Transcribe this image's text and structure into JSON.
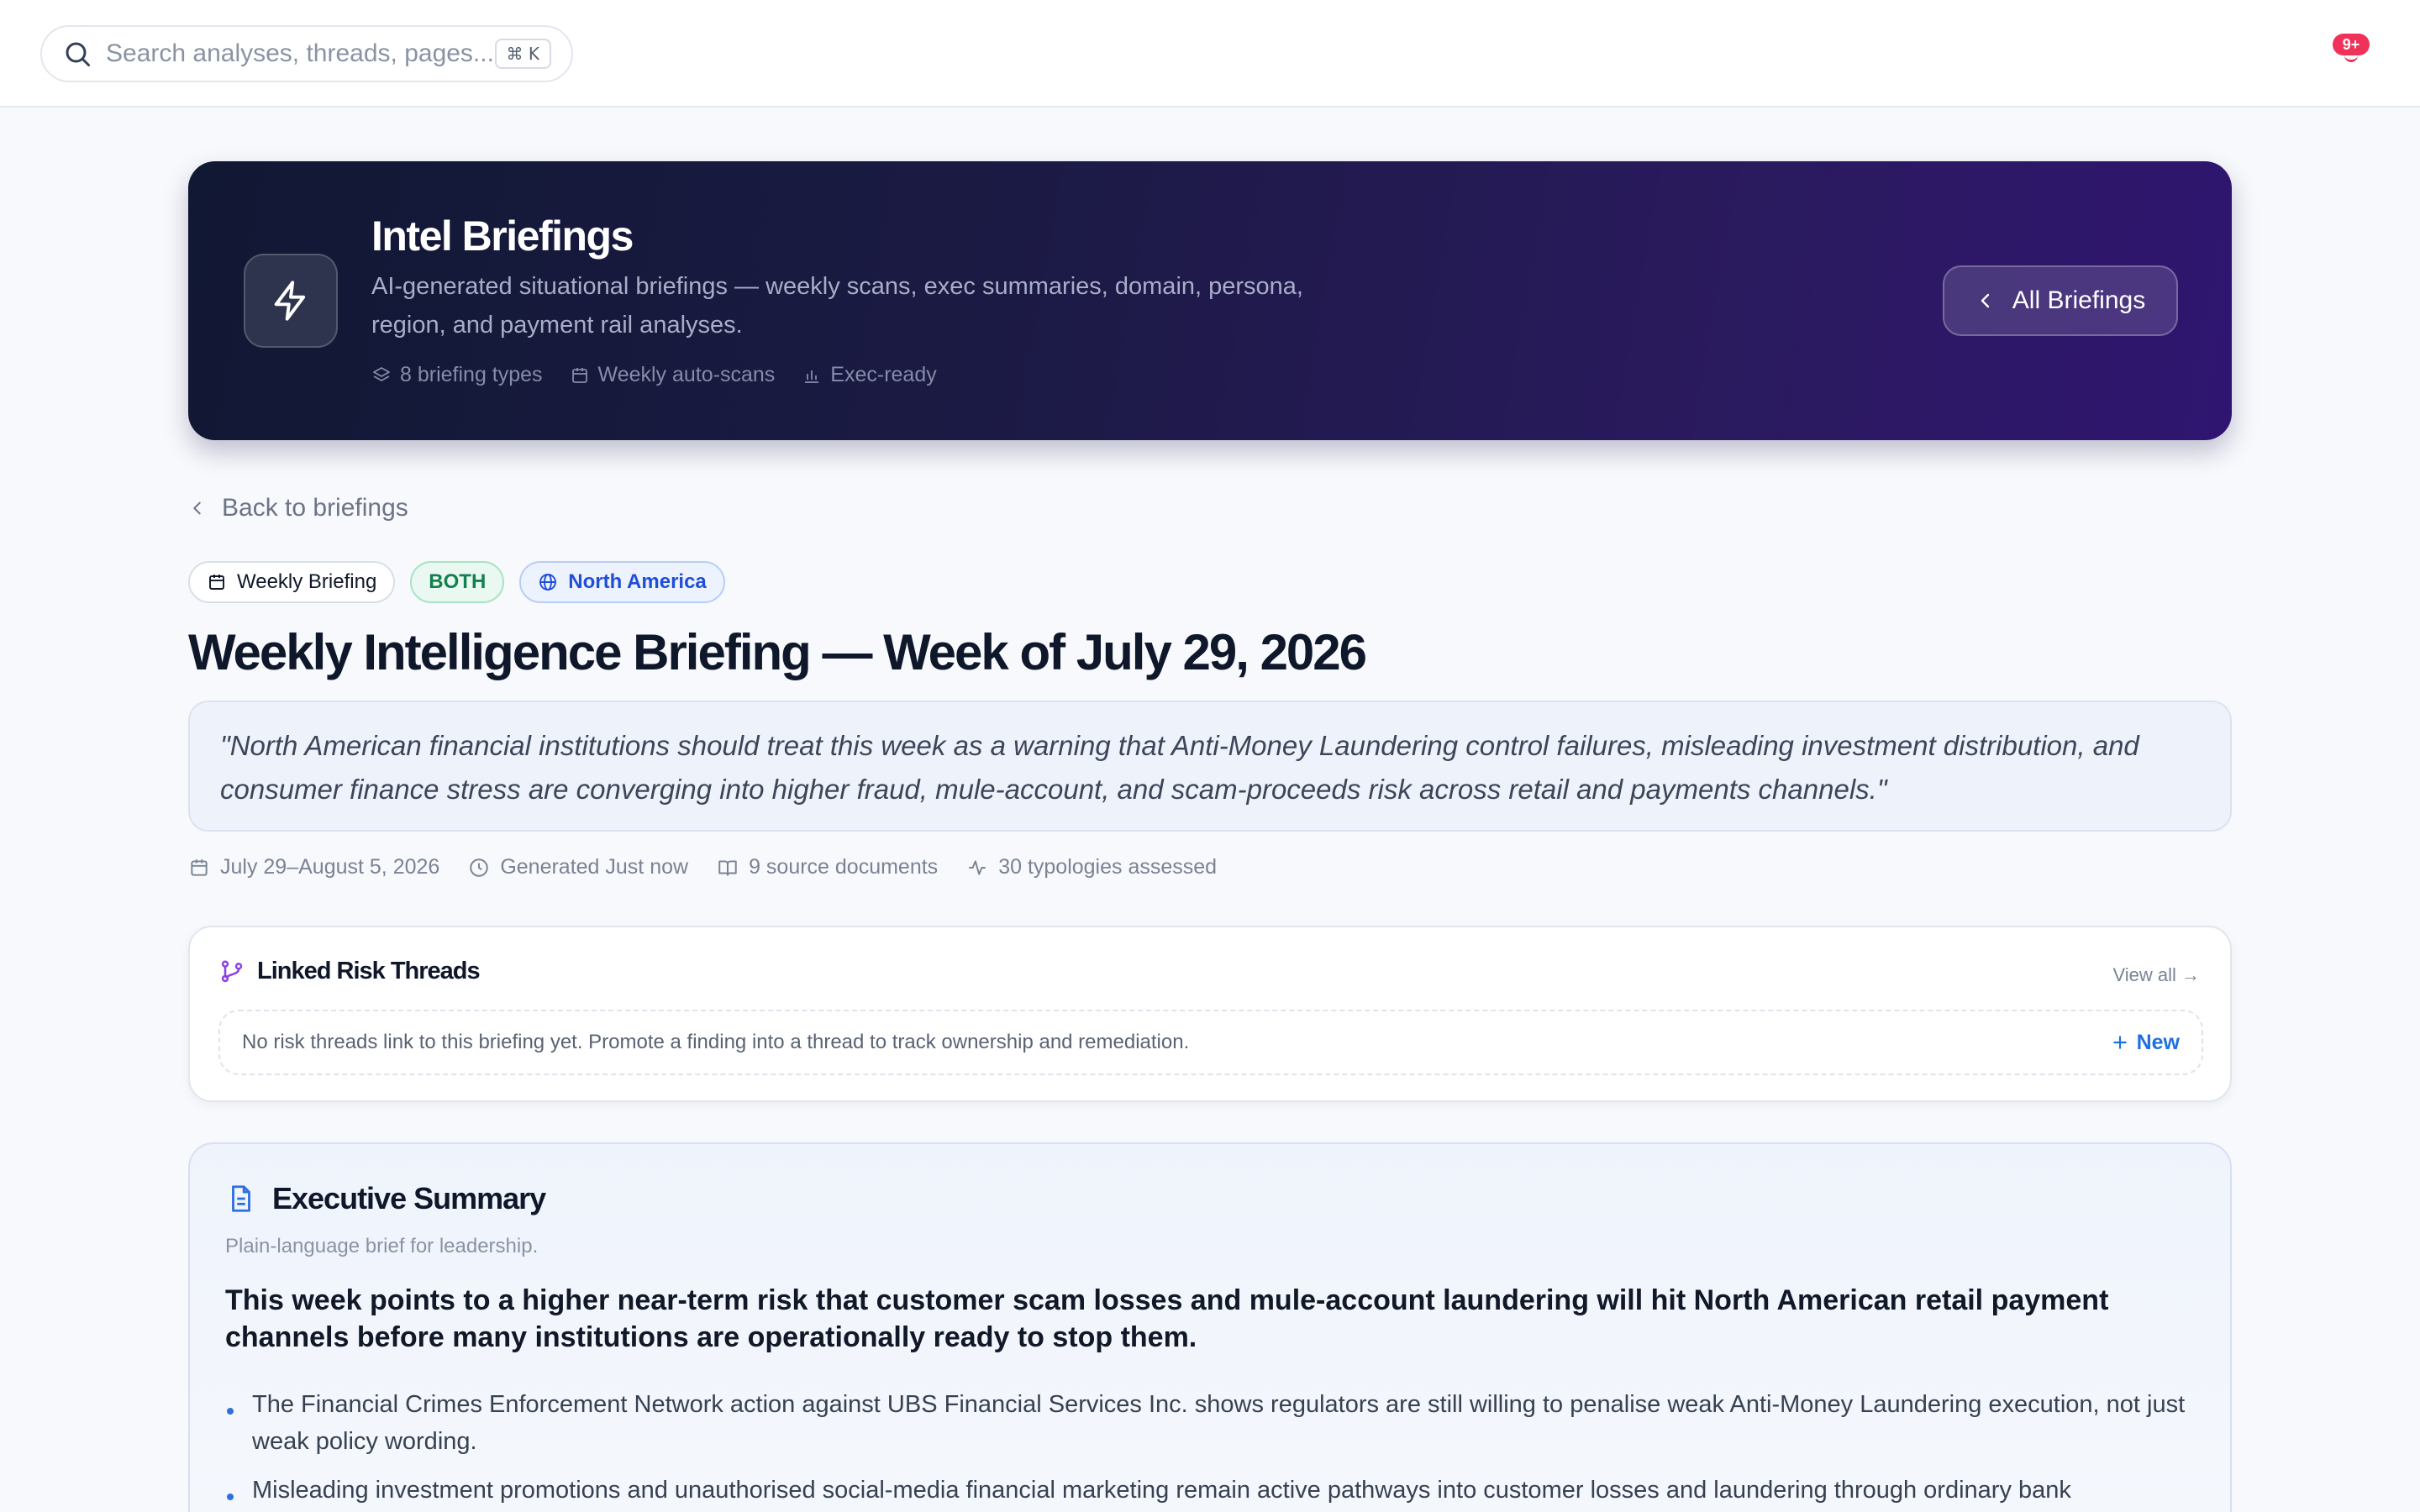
{
  "search": {
    "placeholder": "Search analyses, threads, pages...",
    "shortcut": "⌘ K"
  },
  "notifications": {
    "badge": "9+"
  },
  "hero": {
    "title": "Intel Briefings",
    "subtitle": "AI-generated situational briefings — weekly scans, exec summaries, domain, persona, region, and payment rail analyses.",
    "meta": [
      {
        "icon": "layers-icon",
        "label": "8 briefing types"
      },
      {
        "icon": "calendar-icon",
        "label": "Weekly auto-scans"
      },
      {
        "icon": "bar-chart-icon",
        "label": "Exec-ready"
      }
    ],
    "button_label": "All Briefings"
  },
  "back_label": "Back to briefings",
  "badges": {
    "type": "Weekly Briefing",
    "scope": "BOTH",
    "region": "North America"
  },
  "title": "Weekly Intelligence Briefing — Week of July 29, 2026",
  "quote": "\"North American financial institutions should treat this week as a warning that Anti-Money Laundering control failures, misleading investment distribution, and consumer finance stress are converging into higher fraud, mule-account, and scam-proceeds risk across retail and payments channels.\"",
  "meta": {
    "date_range": "July 29–August 5, 2026",
    "generated": "Generated Just now",
    "sources": "9 source documents",
    "typologies": "30 typologies assessed"
  },
  "threads": {
    "title": "Linked Risk Threads",
    "view_all": "View all →",
    "empty_text": "No risk threads link to this briefing yet. Promote a finding into a thread to track ownership and remediation.",
    "new_label": "New"
  },
  "executive_summary": {
    "title": "Executive Summary",
    "subtitle": "Plain-language brief for leadership.",
    "lead": "This week points to a higher near-term risk that customer scam losses and mule-account laundering will hit North American retail payment channels before many institutions are operationally ready to stop them.",
    "bullets": [
      "The Financial Crimes Enforcement Network action against UBS Financial Services Inc. shows regulators are still willing to penalise weak Anti-Money Laundering execution, not just weak policy wording.",
      "Misleading investment promotions and unauthorised social-media financial marketing remain active pathways into customer losses and laundering through ordinary bank"
    ]
  },
  "colors": {
    "accent": "#1f6fe0",
    "hero_start": "#111833",
    "hero_end": "#2f1570",
    "badge_red": "#f0325a",
    "both_green": "#13804e",
    "region_blue": "#1f4ed8"
  }
}
